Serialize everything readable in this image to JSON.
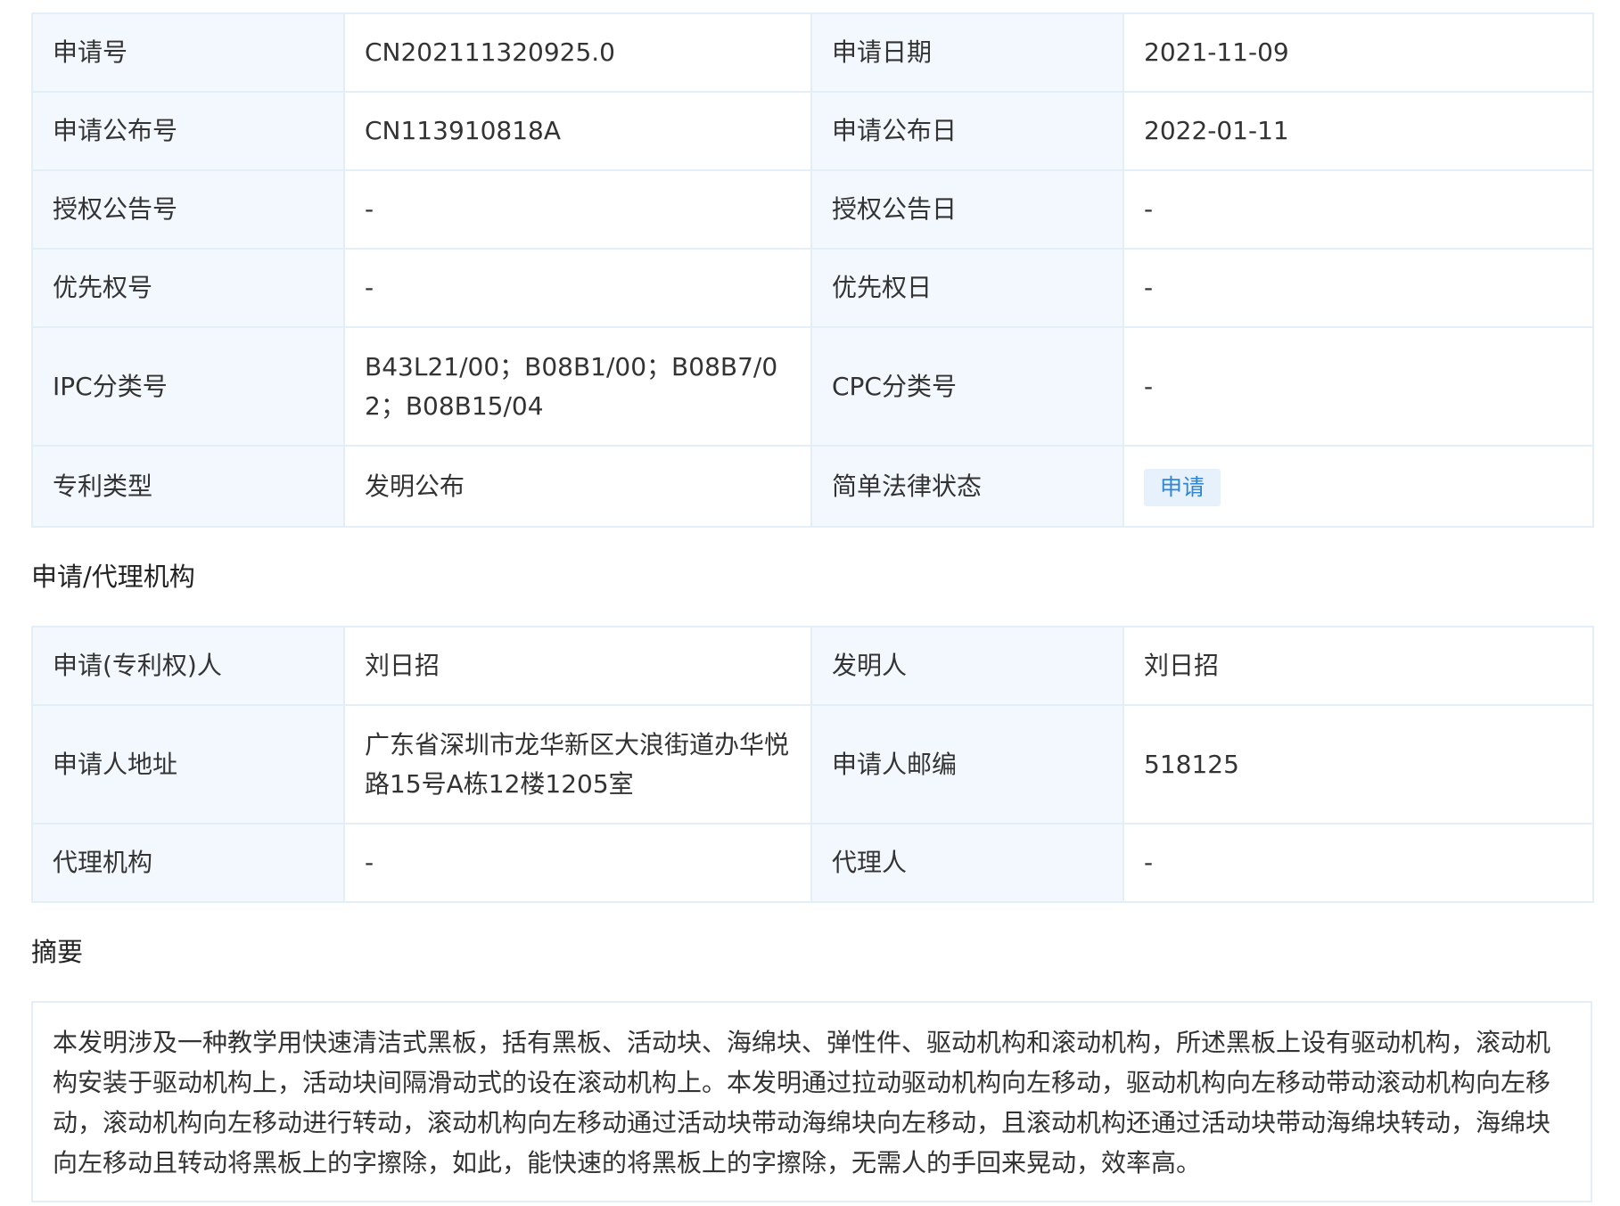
{
  "basic_info": {
    "rows": [
      {
        "l1": "申请号",
        "v1": "CN202111320925.0",
        "l2": "申请日期",
        "v2": "2021-11-09"
      },
      {
        "l1": "申请公布号",
        "v1": "CN113910818A",
        "l2": "申请公布日",
        "v2": "2022-01-11"
      },
      {
        "l1": "授权公告号",
        "v1": "-",
        "l2": "授权公告日",
        "v2": "-"
      },
      {
        "l1": "优先权号",
        "v1": "-",
        "l2": "优先权日",
        "v2": "-"
      },
      {
        "l1": "IPC分类号",
        "v1": "B43L21/00；B08B1/00；B08B7/02；B08B15/04",
        "l2": "CPC分类号",
        "v2": "-"
      },
      {
        "l1": "专利类型",
        "v1": "发明公布",
        "l2": "简单法律状态",
        "v2": "申请"
      }
    ]
  },
  "agency": {
    "title": "申请/代理机构",
    "rows": [
      {
        "l1": "申请(专利权)人",
        "v1": "刘日招",
        "l2": "发明人",
        "v2": "刘日招"
      },
      {
        "l1": "申请人地址",
        "v1": "广东省深圳市龙华新区大浪街道办华悦路15号A栋12楼1205室",
        "l2": "申请人邮编",
        "v2": "518125"
      },
      {
        "l1": "代理机构",
        "v1": "-",
        "l2": "代理人",
        "v2": "-"
      }
    ]
  },
  "abstract": {
    "title": "摘要",
    "text": "本发明涉及一种教学用快速清洁式黑板，括有黑板、活动块、海绵块、弹性件、驱动机构和滚动机构，所述黑板上设有驱动机构，滚动机构安装于驱动机构上，活动块间隔滑动式的设在滚动机构上。本发明通过拉动驱动机构向左移动，驱动机构向左移动带动滚动机构向左移动，滚动机构向左移动进行转动，滚动机构向左移动通过活动块带动海绵块向左移动，且滚动机构还通过活动块带动海绵块转动，海绵块向左移动且转动将黑板上的字擦除，如此，能快速的将黑板上的字擦除，无需人的手回来晃动，效率高。"
  },
  "colors": {
    "label_bg": "#f2f8fd",
    "border": "#e3eef7",
    "badge_bg": "#e6f1fc",
    "badge_text": "#2f86d8"
  }
}
